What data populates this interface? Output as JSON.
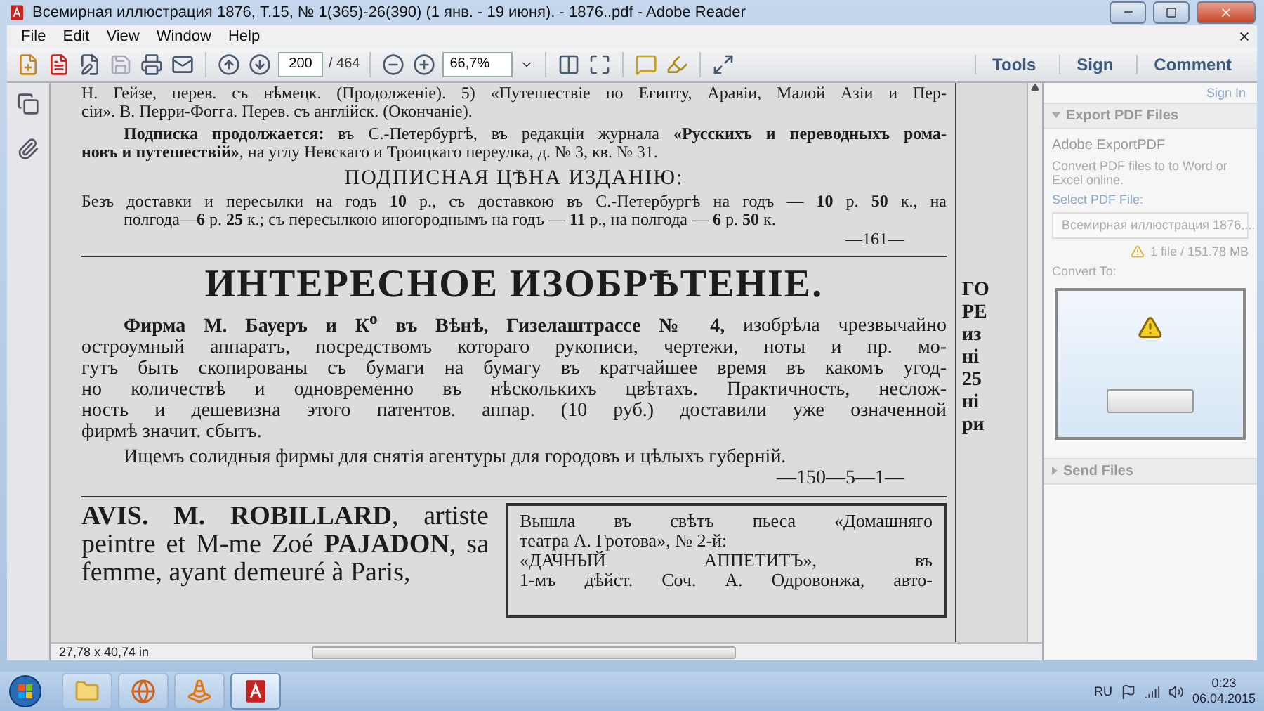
{
  "window": {
    "title": "Всемирная иллюстрация 1876, Т.15, № 1(365)-26(390) (1 янв. - 19 июня). - 1876..pdf - Adobe Reader"
  },
  "menu": [
    "File",
    "Edit",
    "View",
    "Window",
    "Help"
  ],
  "toolbar": {
    "page": "200",
    "page_count": "/ 464",
    "zoom": "66,7%",
    "tools": [
      "Tools",
      "Sign",
      "Comment"
    ]
  },
  "document": {
    "top_paragraphs": [
      [
        "Н. Гейзе, перев. съ нѣмецк. (Продолженіе). 5) «Путешествіе по Египту, Аравіи, Малой Азіи и Пер-",
        "сіи». В. Перри-Фогга. Перев. съ англійск. (Окончаніе)."
      ],
      [
        "**Подписка продолжается:** въ С.-Петербургѣ, въ редакціи журнала **«Русскихъ и переводныхъ рома-**",
        "**новъ и путешествій»**, на углу Невскаго и Троицкаго переулка, д. № 3, кв. № 31."
      ]
    ],
    "price_heading": "ПОДПИСНАЯ ЦѢНА ИЗДАНІЮ:",
    "price_lines": [
      "Безъ доставки и пересылки на годъ **10** р., съ доставкою въ С.-Петербургѣ на годъ — **10** р. **50** к., на",
      "полгода—**6** р. **25** к.; съ пересылкою иногороднымъ на годъ — **11** р., на полгода — **6** р. **50** к."
    ],
    "page_mark": "—161—",
    "article": {
      "title": "ИНТЕРЕСНОЕ ИЗОБРѢТЕНІЕ.",
      "lines": [
        "**Фирма М. Бауеръ и К$^{о}$ въ Вѣнѣ, Гизелаштрассе № 4,** изобрѣла чрезвычайно",
        "остроумный аппаратъ, посредствомъ котораго рукописи, чертежи, ноты и пр. мо-",
        "гутъ быть скопированы съ бумаги на бумагу въ кратчайшее время въ какомъ угод-",
        "но количествѣ и одновременно въ нѣсколькихъ цвѣтахъ. Практичность, неслож-",
        "ность и дешевизна этого патентов. аппар. (10 руб.) доставили уже означенной",
        "фирмѣ значит. сбытъ."
      ],
      "closing": "Ищемъ солидныя фирмы для снятія агентуры для городовъ и цѣлыхъ губерній.",
      "code": "—150—5—1—"
    },
    "avis_lines": [
      "**AVIS. M. ROBILLARD**, artiste",
      "peintre et M-me Zoé **PAJADON**, sa",
      "femme, ayant demeuré à Paris,"
    ],
    "notice_lines": [
      "Вышла въ свѣтъ пьеса «Домашняго",
      "театра А. Гротова», № 2-й:",
      "«ДАЧНЫЙ АППЕТИТЪ», въ",
      "1-мъ дѣйст. Соч. А. Одровонжа, авто-"
    ],
    "next_column": [
      "ГО",
      "РЕ",
      "из",
      "ні",
      "25",
      "ні",
      "ри"
    ]
  },
  "status": {
    "size": "27,78 x 40,74 in"
  },
  "right_pane": {
    "sign_in": "Sign In",
    "sections": [
      {
        "title": "Export PDF Files",
        "expanded": true
      },
      {
        "title": "Send Files",
        "expanded": false
      }
    ],
    "service": "Adobe ExportPDF",
    "description": "Convert PDF files to to Word or Excel online.",
    "select_label": "Select PDF File:",
    "file": "Всемирная иллюстрация 1876,...",
    "file_info": "1 file / 151.78 MB",
    "convert_label": "Convert To:"
  },
  "taskbar": {
    "apps": [
      {
        "kind": "folder",
        "selected": false
      },
      {
        "kind": "browser",
        "selected": false
      },
      {
        "kind": "cone",
        "selected": false
      },
      {
        "kind": "reader",
        "selected": true
      }
    ],
    "language": "RU",
    "time": "0:23",
    "date": "06.04.2015"
  }
}
